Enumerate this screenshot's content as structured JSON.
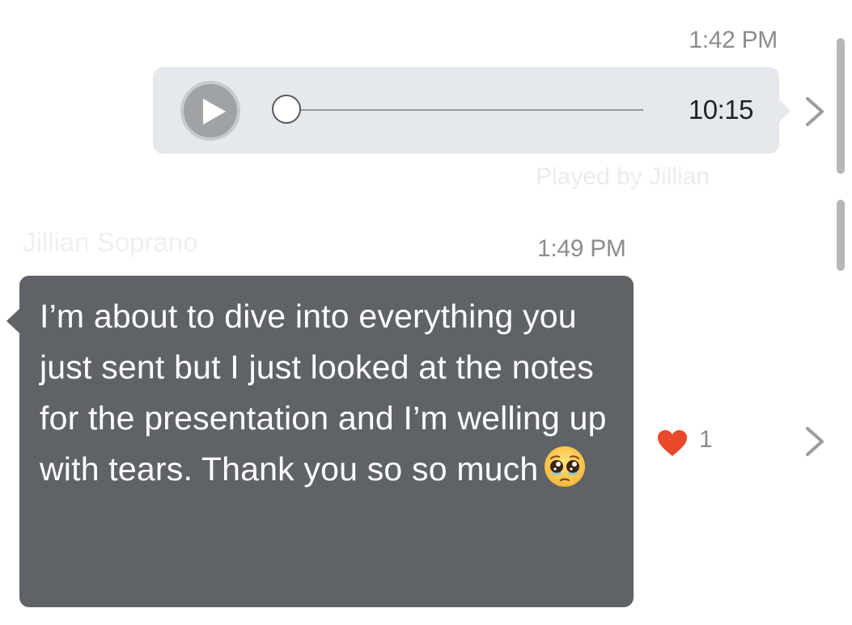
{
  "voice_message": {
    "timestamp": "1:42 PM",
    "duration": "10:15",
    "progress": 0,
    "played_status": "Played by Jillian"
  },
  "text_message": {
    "sender": "Jillian Soprano",
    "timestamp": "1:49 PM",
    "text": "I’m about to dive into everything you just sent but I just looked at the notes for the presentation and I’m welling up with tears. Thank you so so much",
    "emoji": "pleading-face-emoji"
  },
  "reaction": {
    "icon": "heart-icon",
    "count": "1",
    "color": "#e8492a"
  },
  "colors": {
    "voice_bubble": "#e5e9ee",
    "message_bubble": "#5f6368",
    "timestamp": "#8c8c8c"
  },
  "icons": [
    "play-icon",
    "chevron-right-icon",
    "heart-icon",
    "pleading-face-emoji"
  ]
}
